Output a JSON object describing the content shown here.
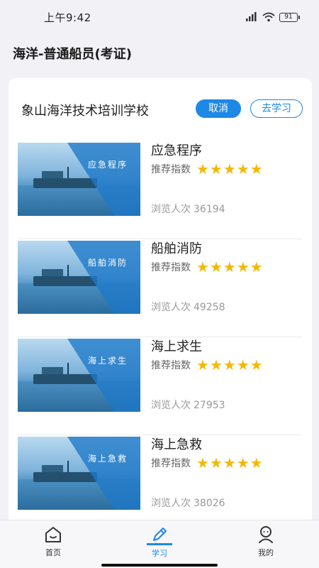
{
  "status_bar": {
    "time": "上午9:42",
    "battery": "91",
    "icons": [
      "signal-icon",
      "wifi-icon",
      "battery-icon"
    ]
  },
  "header": {
    "title": "海洋-普通船员(考证)"
  },
  "school": {
    "name": "象山海洋技术培训学校",
    "cancel_label": "取消",
    "study_label": "去学习"
  },
  "courses": [
    {
      "title": "应急程序",
      "thumb_caption": "应急程序",
      "rec_label": "推荐指数",
      "stars": 5,
      "views_label": "浏览人次",
      "views": "36194"
    },
    {
      "title": "船舶消防",
      "thumb_caption": "船舶消防",
      "rec_label": "推荐指数",
      "stars": 5,
      "views_label": "浏览人次",
      "views": "49258"
    },
    {
      "title": "海上求生",
      "thumb_caption": "海上求生",
      "rec_label": "推荐指数",
      "stars": 5,
      "views_label": "浏览人次",
      "views": "27953"
    },
    {
      "title": "海上急救",
      "thumb_caption": "海上急救",
      "rec_label": "推荐指数",
      "stars": 5,
      "views_label": "浏览人次",
      "views": "38026"
    }
  ],
  "nav": {
    "items": [
      {
        "label": "首页",
        "icon": "home-icon",
        "active": false
      },
      {
        "label": "学习",
        "icon": "pen-icon",
        "active": true
      },
      {
        "label": "我的",
        "icon": "profile-icon",
        "active": false
      }
    ]
  },
  "colors": {
    "accent": "#1e88e5",
    "star": "#f5b800"
  }
}
